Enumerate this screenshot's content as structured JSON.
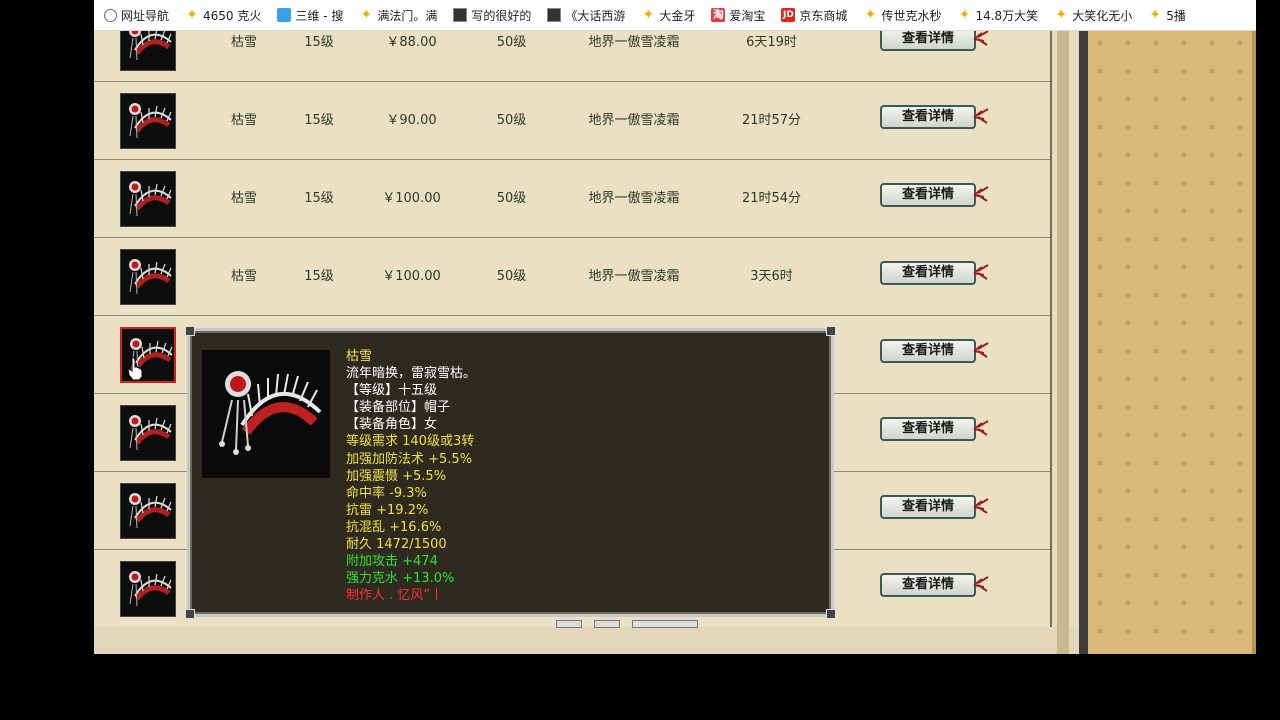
{
  "bookmarks": [
    {
      "label": "网址导航",
      "icon": "globe-icon"
    },
    {
      "label": "4650 克火",
      "icon": "star-icon"
    },
    {
      "label": "三维 - 搜",
      "icon": "tv-icon"
    },
    {
      "label": "满法门。满",
      "icon": "star-icon"
    },
    {
      "label": "写的很好的",
      "icon": "page-icon"
    },
    {
      "label": "《大话西游",
      "icon": "page-icon"
    },
    {
      "label": "大金牙",
      "icon": "star-icon"
    },
    {
      "label": "爱淘宝",
      "icon": "taobao-icon",
      "icon_text": "淘"
    },
    {
      "label": "京东商城",
      "icon": "jd-icon",
      "icon_text": "JD"
    },
    {
      "label": "传世克水秒",
      "icon": "star-icon"
    },
    {
      "label": "14.8万大笑",
      "icon": "star-icon"
    },
    {
      "label": "大笑化无小",
      "icon": "star-icon"
    },
    {
      "label": "5播",
      "icon": "star-icon"
    }
  ],
  "rows": [
    {
      "name": "枯雪",
      "level": "15级",
      "price": "￥88.00",
      "req": "50级",
      "server": "地界一傲雪凌霜",
      "time": "6天19时",
      "button": "查看详情"
    },
    {
      "name": "枯雪",
      "level": "15级",
      "price": "￥90.00",
      "req": "50级",
      "server": "地界一傲雪凌霜",
      "time": "21时57分",
      "button": "查看详情"
    },
    {
      "name": "枯雪",
      "level": "15级",
      "price": "￥100.00",
      "req": "50级",
      "server": "地界一傲雪凌霜",
      "time": "21时54分",
      "button": "查看详情"
    },
    {
      "name": "枯雪",
      "level": "15级",
      "price": "￥100.00",
      "req": "50级",
      "server": "地界一傲雪凌霜",
      "time": "3天6时",
      "button": "查看详情"
    },
    {
      "name": "",
      "level": "",
      "price": "",
      "req": "",
      "server": "",
      "time": "",
      "button": "查看详情"
    },
    {
      "name": "",
      "level": "",
      "price": "",
      "req": "",
      "server": "",
      "time": "",
      "button": "查看详情"
    },
    {
      "name": "",
      "level": "",
      "price": "",
      "req": "",
      "server": "",
      "time": "",
      "button": "查看详情"
    },
    {
      "name": "",
      "level": "",
      "price": "",
      "req": "",
      "server": "",
      "time": "",
      "button": "查看详情"
    }
  ],
  "tooltip": {
    "lines": [
      {
        "text": "枯雪",
        "color": "y"
      },
      {
        "text": "流年暗换，雷寂雪枯。",
        "color": "w"
      },
      {
        "text": "【等级】十五级",
        "color": "w"
      },
      {
        "text": "【装备部位】帽子",
        "color": "w"
      },
      {
        "text": "【装备角色】女",
        "color": "w"
      },
      {
        "text": "等级需求 140级或3转",
        "color": "y"
      },
      {
        "text": "加强加防法术 +5.5%",
        "color": "y"
      },
      {
        "text": "加强震慑 +5.5%",
        "color": "y"
      },
      {
        "text": "命中率 -9.3%",
        "color": "y"
      },
      {
        "text": "抗雷 +19.2%",
        "color": "y"
      },
      {
        "text": "抗混乱 +16.6%",
        "color": "y"
      },
      {
        "text": "耐久 1472/1500",
        "color": "y"
      },
      {
        "text": "附加攻击 +474",
        "color": "g"
      },
      {
        "text": "强力克水 +13.0%",
        "color": "g"
      },
      {
        "text": "制作人 . 忆风”丨",
        "color": "r"
      }
    ]
  }
}
